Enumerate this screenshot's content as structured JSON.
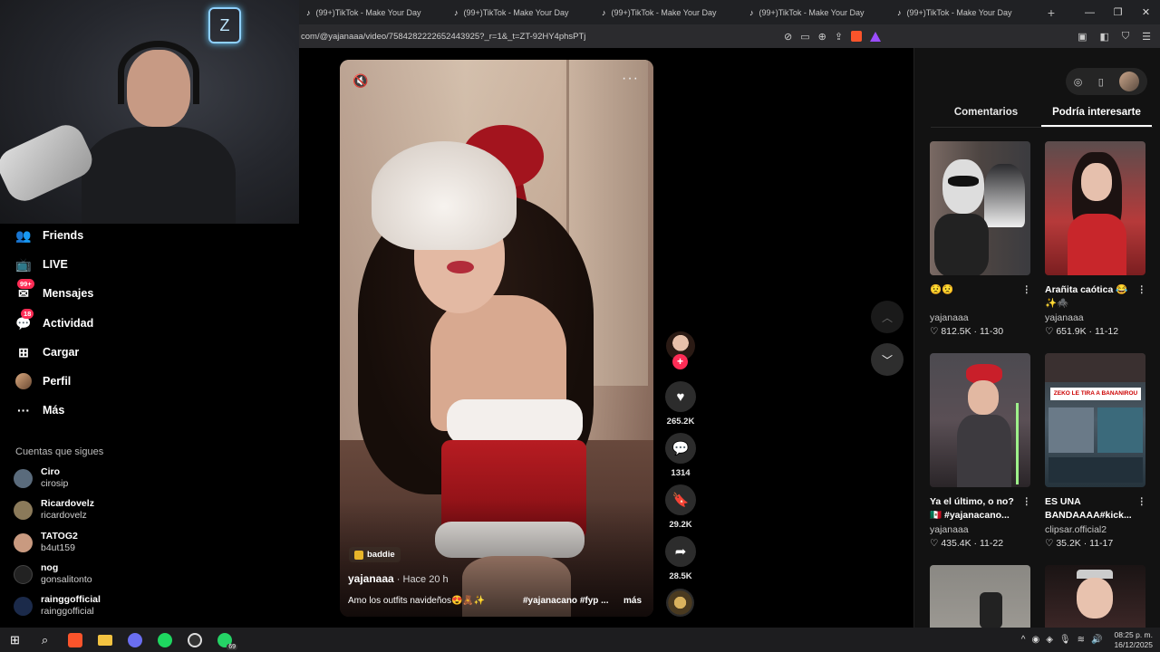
{
  "browser": {
    "tabs": [
      {
        "label": "(99+)TikTok - Make Your Day"
      },
      {
        "label": "(99+)TikTok - Make Your Day"
      },
      {
        "label": "(99+)TikTok - Make Your Day"
      },
      {
        "label": "(99+)TikTok - Make Your Day"
      },
      {
        "label": "(99+)TikTok - Make Your Day"
      }
    ],
    "new_tab": "+",
    "url": "com/@yajanaaa/video/7584282222652443925?_r=1&_t=ZT-92HY4phsPTj"
  },
  "sidebar": {
    "items": [
      {
        "label": "Friends",
        "icon": "friends-icon"
      },
      {
        "label": "LIVE",
        "icon": "live-icon"
      },
      {
        "label": "Mensajes",
        "icon": "messages-icon",
        "badge": "99+"
      },
      {
        "label": "Actividad",
        "icon": "activity-icon",
        "badge": "18"
      },
      {
        "label": "Cargar",
        "icon": "upload-icon"
      },
      {
        "label": "Perfil",
        "icon": "profile-avatar"
      },
      {
        "label": "Más",
        "icon": "more-icon"
      }
    ],
    "following_title": "Cuentas que sigues",
    "following": [
      {
        "name": "Ciro",
        "handle": "cirosip",
        "color": "#5a6b7c"
      },
      {
        "name": "Ricardovelz",
        "handle": "ricardovelz",
        "color": "#8b7a5a"
      },
      {
        "name": "TATOG2",
        "handle": "b4ut159",
        "color": "#c99a80"
      },
      {
        "name": "nog",
        "handle": "gonsalitonto",
        "color": "#222222"
      },
      {
        "name": "rainggofficial",
        "handle": "rainggofficial",
        "color": "#1b2a4a"
      }
    ]
  },
  "video": {
    "tag": "baddie",
    "author": "yajanaaa",
    "time": " · Hace 20 h",
    "caption": "Amo los outfits navideños😍🧸✨",
    "hashtags": "#yajanacano #fyp ...",
    "more": "más"
  },
  "actions": {
    "likes": "265.2K",
    "comments": "1314",
    "saves": "29.2K",
    "shares": "28.5K"
  },
  "panel": {
    "tabs": [
      "Comentarios",
      "Podría interesarte"
    ],
    "cards": [
      {
        "title": "😟😟",
        "author": "yajanaaa",
        "likes": "812.5K",
        "date": "11-30"
      },
      {
        "title": "Arañita caótica 😂✨🕷️",
        "author": "yajanaaa",
        "likes": "651.9K",
        "date": "11-12"
      },
      {
        "title": "Ya el último, o no? 🇲🇽 #yajanacano...",
        "author": "yajanaaa",
        "likes": "435.4K",
        "date": "11-22"
      },
      {
        "title": "ES UNA BANDAAAA#kick...",
        "author": "clipsar.official2",
        "likes": "35.2K",
        "date": "11-17"
      },
      {
        "title": "",
        "author": "",
        "likes": "",
        "date": ""
      },
      {
        "title": "",
        "author": "",
        "likes": "",
        "date": ""
      }
    ],
    "thumb4_text": "ZEKO LE TIRA A BANANIROU"
  },
  "taskbar": {
    "whatsapp_count": "69",
    "time": "08:25 p. m.",
    "date": "16/12/2025"
  }
}
